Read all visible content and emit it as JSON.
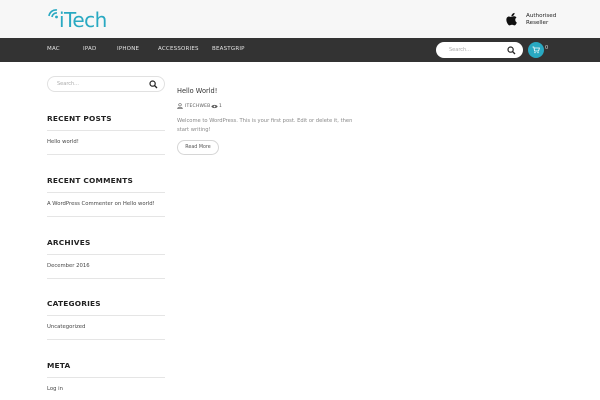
{
  "header": {
    "logo_text": "iTech",
    "reseller_line1": "Authorised",
    "reseller_line2": "Reseller"
  },
  "nav": {
    "items": [
      "MAC",
      "IPAD",
      "IPHONE",
      "ACCESSORIES",
      "BEASTGRIP"
    ],
    "search_placeholder": "Search...",
    "cart_count": "0"
  },
  "sidebar": {
    "search_placeholder": "Search...",
    "recent_posts": {
      "title": "RECENT POSTS",
      "items": [
        "Hello world!"
      ]
    },
    "recent_comments": {
      "title": "RECENT COMMENTS",
      "author": "A WordPress Commenter",
      "connector": "on",
      "post": "Hello world!"
    },
    "archives": {
      "title": "ARCHIVES",
      "items": [
        "December 2016"
      ]
    },
    "categories": {
      "title": "CATEGORIES",
      "items": [
        "Uncategorized"
      ]
    },
    "meta": {
      "title": "META",
      "items": [
        "Log in"
      ]
    }
  },
  "post": {
    "title": "Hello World!",
    "author": "ITECHWEB",
    "views": "1",
    "excerpt": "Welcome to WordPress. This is your first post. Edit or delete it, then start writing!",
    "read_more": "Read More"
  },
  "colors": {
    "accent": "#29a9c2",
    "navbar": "#333333",
    "header_bg": "#f7f7f7"
  }
}
